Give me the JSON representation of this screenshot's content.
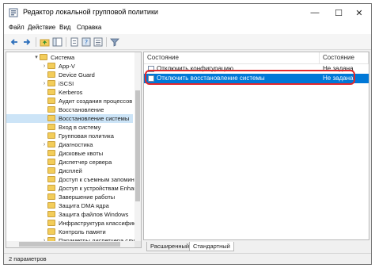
{
  "window": {
    "title": "Редактор локальной групповой политики",
    "minimize": "—",
    "maximize": "☐",
    "close": "✕"
  },
  "menu": [
    {
      "label": "Файл"
    },
    {
      "label": "Действие"
    },
    {
      "label": "Вид"
    },
    {
      "label": "Справка"
    }
  ],
  "toolbar": {
    "icons": [
      "back-arrow-icon",
      "forward-arrow-icon",
      "up-folder-icon",
      "show-hide-tree-icon",
      "properties-icon",
      "help-icon",
      "export-list-icon",
      "filter-icon"
    ]
  },
  "tree": {
    "items": [
      {
        "label": "Система",
        "expander": "▾"
      },
      {
        "label": "App-V",
        "expander": "›"
      },
      {
        "label": "Device Guard",
        "expander": ""
      },
      {
        "label": "iSCSI",
        "expander": "›"
      },
      {
        "label": "Kerberos",
        "expander": ""
      },
      {
        "label": "Аудит создания процессов",
        "expander": ""
      },
      {
        "label": "Восстановление",
        "expander": ""
      },
      {
        "label": "Восстановление системы",
        "expander": ""
      },
      {
        "label": "Вход в систему",
        "expander": ""
      },
      {
        "label": "Групповая политика",
        "expander": ""
      },
      {
        "label": "Диагностика",
        "expander": "›"
      },
      {
        "label": "Дисковые квоты",
        "expander": ""
      },
      {
        "label": "Диспетчер сервера",
        "expander": ""
      },
      {
        "label": "Дисплей",
        "expander": ""
      },
      {
        "label": "Доступ к съемным запомин",
        "expander": ""
      },
      {
        "label": "Доступ к устройствам Enhar",
        "expander": ""
      },
      {
        "label": "Завершение работы",
        "expander": ""
      },
      {
        "label": "Защита DMA ядра",
        "expander": ""
      },
      {
        "label": "Защита файлов Windows",
        "expander": ""
      },
      {
        "label": "Инфраструктура классифик",
        "expander": ""
      },
      {
        "label": "Контроль памяти",
        "expander": ""
      },
      {
        "label": "Параметры диспетчера слу",
        "expander": "›"
      }
    ],
    "selected_index": 7
  },
  "list": {
    "columns": {
      "name": "Состояние",
      "state": "Состояние"
    },
    "rows": [
      {
        "name": "Отключить конфигурацию",
        "state": "Не задана"
      },
      {
        "name": "Отключить восстановление системы",
        "state": "Не задана"
      }
    ],
    "selected_index": 1
  },
  "tabs": [
    {
      "label": "Расширенный"
    },
    {
      "label": "Стандартный"
    }
  ],
  "status": {
    "text": "2 параметров"
  },
  "colors": {
    "selection": "#0078d7",
    "highlight_ring": "#e3262a",
    "folder": "#f3cd5a"
  }
}
